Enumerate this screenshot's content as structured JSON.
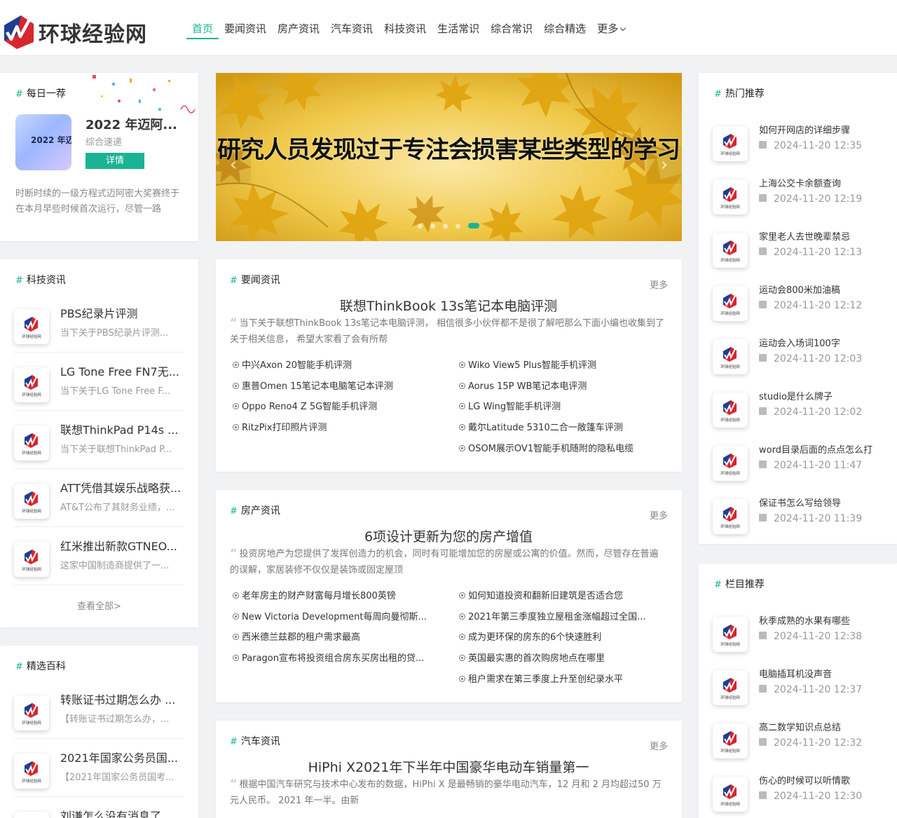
{
  "brand": {
    "name": "环球经验网",
    "accent": "#1ab394"
  },
  "nav": {
    "items": [
      "首页",
      "要闻资讯",
      "房产资讯",
      "汽车资讯",
      "科技资讯",
      "生活常识",
      "综合常识",
      "综合精选"
    ],
    "more": "更多"
  },
  "daily": {
    "title": "每日一荐",
    "thumb_text": "2022 年迈",
    "name": "2022 年迈阿...",
    "category": "综合速递",
    "btn": "详情",
    "desc": "时断时续的一级方程式迈阿密大奖赛终于在本月早些时候首次运行，尽管一路"
  },
  "banner": {
    "caption": "研究人员发现过于专注会损害某些类型的学习",
    "prev": "‹",
    "next": "›",
    "slide_count": 5,
    "active_slide": 5
  },
  "tech": {
    "title": "科技资讯",
    "items": [
      {
        "title": "PBS纪录片评测",
        "desc": "当下关于PBS纪录片评测..."
      },
      {
        "title": "LG Tone Free FN7无...",
        "desc": "当下关于LG Tone Free F..."
      },
      {
        "title": "联想ThinkPad P14s ...",
        "desc": "当下关于联想ThinkPad P..."
      },
      {
        "title": "ATT凭借其娱乐战略获...",
        "desc": "AT&T公布了其财务业绩，..."
      },
      {
        "title": "红米推出新款GTNEO...",
        "desc": "这家中国制造商提供了一..."
      }
    ],
    "view_all": "查看全部>"
  },
  "picks": {
    "title": "精选百科",
    "items": [
      {
        "title": "转账证书过期怎么办 ...",
        "desc": "【转账证书过期怎么办，..."
      },
      {
        "title": "2021年国家公务员国...",
        "desc": "【2021年国家公务员国考..."
      },
      {
        "title": "刘谦怎么没有消息了 ...",
        "desc": ""
      }
    ]
  },
  "news_sections": [
    {
      "title": "要闻资讯",
      "more": "更多",
      "headline": "联想ThinkBook 13s笔记本电脑评测",
      "summary": "当下关于联想ThinkBook 13s笔记本电脑评测， 相信很多小伙伴都不是很了解吧那么下面小编也收集到了关于相关信息， 希望大家看了会有所帮",
      "links": [
        "中兴Axon 20智能手机评测",
        "Wiko View5 Plus智能手机评测",
        "惠普Omen 15笔记本电脑笔记本评测",
        "Aorus 15P WB笔记本电评测",
        "Oppo Reno4 Z 5G智能手机评测",
        "LG Wing智能手机评测",
        "RitzPix打印照片评测",
        "戴尔Latitude 5310二合一敞篷车评测",
        "",
        "OSOM展示OV1智能手机随附的隐私电缆"
      ]
    },
    {
      "title": "房产资讯",
      "more": "更多",
      "headline": "6项设计更新为您的房产增值",
      "summary": "投资房地产为您提供了发挥创造力的机会，同时有可能增加您的房屋或公寓的价值。然而，尽管存在普遍的误解，家居装修不仅仅是装饰或固定屋顶",
      "links": [
        "老年房主的财产财富每月增长800英镑",
        "如何知道投资和翻新旧建筑是否适合您",
        "New Victoria Development每周向曼彻斯...",
        "2021年第三季度独立屋租金涨幅超过全国...",
        "西米德兰兹郡的租户需求最高",
        "成为更环保的房东的6个快速胜利",
        "Paragon宣布将投资组合房东买房出租的贷...",
        "英国最实惠的首次购房地点在哪里",
        "",
        "租户需求在第三季度上升至创纪录水平"
      ]
    },
    {
      "title": "汽车资讯",
      "more": "更多",
      "headline": "HiPhi X2021年下半年中国豪华电动车销量第一",
      "summary": "根据中国汽车研究与技术中心发布的数据，HiPhi X 是最畅销的豪华电动汽车，12 月和 2 月均超过50 万元人民币。 2021 年一半。由新",
      "links": []
    }
  ],
  "hot": {
    "title": "热门推荐",
    "items": [
      {
        "title": "如何开网店的详细步骤",
        "date": "2024-11-20 12:35"
      },
      {
        "title": "上海公交卡余额查询",
        "date": "2024-11-20 12:19"
      },
      {
        "title": "家里老人去世晚辈禁忌",
        "date": "2024-11-20 12:13"
      },
      {
        "title": "运动会800米加油稿",
        "date": "2024-11-20 12:12"
      },
      {
        "title": "运动会入场词100字",
        "date": "2024-11-20 12:03"
      },
      {
        "title": "studio是什么牌子",
        "date": "2024-11-20 12:02"
      },
      {
        "title": "word目录后面的点点怎么打",
        "date": "2024-11-20 11:47"
      },
      {
        "title": "保证书怎么写给领导",
        "date": "2024-11-20 11:39"
      }
    ]
  },
  "column": {
    "title": "栏目推荐",
    "items": [
      {
        "title": "秋季成熟的水果有哪些",
        "date": "2024-11-20 12:38"
      },
      {
        "title": "电脑插耳机没声音",
        "date": "2024-11-20 12:37"
      },
      {
        "title": "高二数学知识点总结",
        "date": "2024-11-20 12:32"
      },
      {
        "title": "伤心的时候可以听情歌",
        "date": "2024-11-20 12:30"
      }
    ]
  },
  "thumb_logo_text": "环球经验网"
}
